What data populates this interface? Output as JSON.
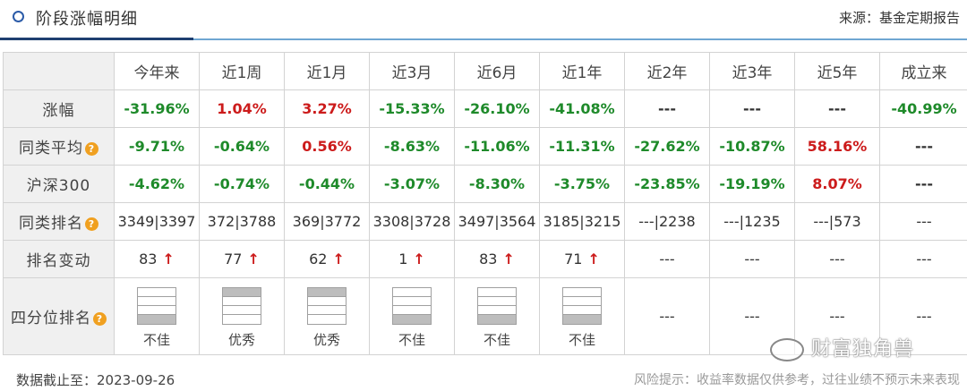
{
  "header": {
    "title": "阶段涨幅明细",
    "source": "来源：基金定期报告"
  },
  "columns": [
    "今年来",
    "近1周",
    "近1月",
    "近3月",
    "近6月",
    "近1年",
    "近2年",
    "近3年",
    "近5年",
    "成立来"
  ],
  "rows": {
    "gain": {
      "label": "涨幅",
      "values": [
        "-31.96%",
        "1.04%",
        "3.27%",
        "-15.33%",
        "-26.10%",
        "-41.08%",
        "---",
        "---",
        "---",
        "-40.99%"
      ]
    },
    "peer_avg": {
      "label": "同类平均",
      "values": [
        "-9.71%",
        "-0.64%",
        "0.56%",
        "-8.63%",
        "-11.06%",
        "-11.31%",
        "-27.62%",
        "-10.87%",
        "58.16%",
        "---"
      ]
    },
    "hs300": {
      "label": "沪深300",
      "values": [
        "-4.62%",
        "-0.74%",
        "-0.44%",
        "-3.07%",
        "-8.30%",
        "-3.75%",
        "-23.85%",
        "-19.19%",
        "8.07%",
        "---"
      ]
    },
    "peer_rank": {
      "label": "同类排名",
      "values": [
        "3349|3397",
        "372|3788",
        "369|3772",
        "3308|3728",
        "3497|3564",
        "3185|3215",
        "---|2238",
        "---|1235",
        "---|573",
        "---"
      ]
    },
    "rank_change": {
      "label": "排名变动",
      "values": [
        "83",
        "77",
        "62",
        "1",
        "83",
        "71",
        "---",
        "---",
        "---",
        "---"
      ],
      "arrow": "↑"
    },
    "quartile": {
      "label": "四分位排名",
      "values": [
        "不佳",
        "优秀",
        "优秀",
        "不佳",
        "不佳",
        "不佳",
        "---",
        "---",
        "---",
        "---"
      ],
      "highlight": [
        4,
        1,
        1,
        4,
        4,
        4,
        0,
        0,
        0,
        0
      ]
    }
  },
  "footer": {
    "date": "数据截止至：2023-09-26",
    "risk": "风险提示：收益率数据仅供参考，过往业绩不预示未来表现"
  },
  "watermark": "财富独角兽",
  "colors": {
    "negative": "#1e8a2a",
    "positive": "#cc1b1b",
    "accent": "#2b5ba8",
    "label_bg": "#f0f0f0",
    "icon": "#f0a020"
  }
}
